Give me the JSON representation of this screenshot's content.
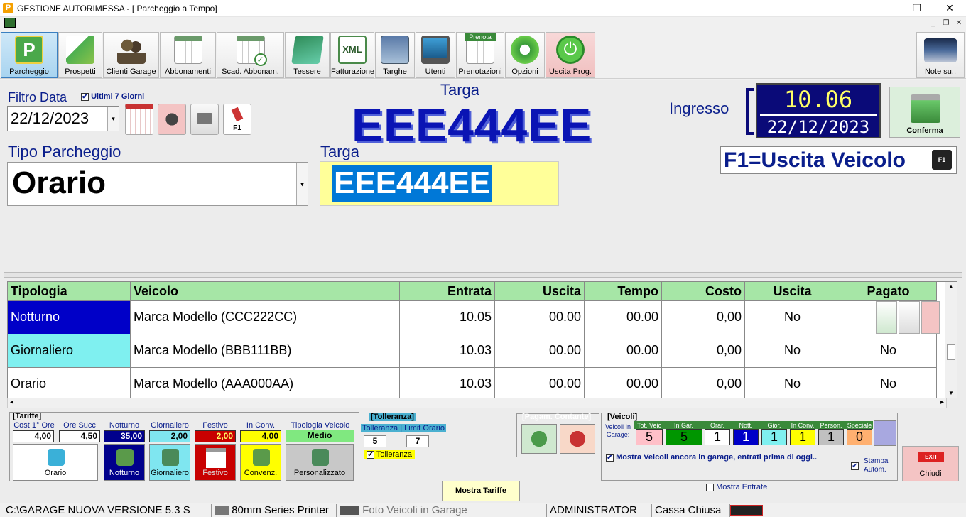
{
  "window": {
    "title": "GESTIONE AUTORIMESSA - [ Parcheggio a Tempo]",
    "app_icon": "P",
    "controls": [
      "–",
      "❐",
      "✕"
    ],
    "mdi_controls": [
      "_",
      "❐",
      "✕"
    ]
  },
  "toolbar": {
    "buttons": [
      {
        "label": "Parcheggio",
        "icon": "parking-icon"
      },
      {
        "label": "Prospetti",
        "icon": "chart-growth-icon"
      },
      {
        "label": "Clienti Garage",
        "icon": "users-icon"
      },
      {
        "label": "Abbonamenti",
        "icon": "calendar-icon"
      },
      {
        "label": "Scad. Abbonam.",
        "icon": "calendar-check-icon"
      },
      {
        "label": "Tessere",
        "icon": "card-icon"
      },
      {
        "label": "Fatturazione",
        "icon": "xml-icon"
      },
      {
        "label": "Targhe",
        "icon": "plates-icon"
      },
      {
        "label": "Utenti",
        "icon": "monitor-icon"
      },
      {
        "label": "Prenotazioni",
        "icon": "booking-icon",
        "badge": "Prenota"
      },
      {
        "label": "Opzioni",
        "icon": "gear-icon"
      },
      {
        "label": "Uscita Prog.",
        "icon": "power-icon"
      },
      {
        "label": "Note su..",
        "icon": "notes-icon"
      }
    ]
  },
  "filter": {
    "label": "Filtro Data",
    "checkbox_label": "Ultimi 7 Giorni",
    "checked": "✔",
    "date": "22/12/2023",
    "dropdown_arrow": "▾",
    "f1_label": "F1"
  },
  "plate_display": {
    "label": "Targa",
    "value": "EEE444EE"
  },
  "tipo": {
    "label": "Tipo Parcheggio",
    "value": "Orario",
    "dropdown_arrow": "▾"
  },
  "targa_input": {
    "label": "Targa",
    "value": "EEE444EE"
  },
  "ingresso": {
    "label": "Ingresso",
    "time": "10.06",
    "date": "22/12/2023"
  },
  "conferma": {
    "label": "Conferma"
  },
  "f1_hint": {
    "label": "F1=Uscita Veicolo",
    "key": "F1"
  },
  "grid": {
    "columns": [
      "Tipologia",
      "Veicolo",
      "Entrata",
      "Uscita",
      "Tempo",
      "Costo",
      "Uscita",
      "Pagato"
    ],
    "rows": [
      {
        "tipologia": "Notturno",
        "veicolo": "Marca Modello (CCC222CC)",
        "entrata": "10.05",
        "uscita": "00.00",
        "tempo": "00.00",
        "costo": "0,00",
        "uscita2": "No",
        "pagato": "",
        "color": "#0000c8",
        "textcolor": "#ffffff"
      },
      {
        "tipologia": "Giornaliero",
        "veicolo": "Marca Modello (BBB111BB)",
        "entrata": "10.03",
        "uscita": "00.00",
        "tempo": "00.00",
        "costo": "0,00",
        "uscita2": "No",
        "pagato": "No",
        "color": "#7ff0f0",
        "textcolor": "#000000"
      },
      {
        "tipologia": "Orario",
        "veicolo": "Marca Modello (AAA000AA)",
        "entrata": "10.03",
        "uscita": "00.00",
        "tempo": "00.00",
        "costo": "0,00",
        "uscita2": "No",
        "pagato": "No",
        "color": "#ffffff",
        "textcolor": "#000000"
      }
    ],
    "scroll_up": "▲",
    "scroll_down": "▼",
    "scroll_left": "◂",
    "scroll_right": "▸"
  },
  "tariffe": {
    "title": "[Tariffe]",
    "cost_first_label": "Cost 1° Ore",
    "cost_first": "4,00",
    "ore_succ_label": "Ore Succ",
    "ore_succ": "4,50",
    "items": [
      {
        "label": "Notturno",
        "value": "35,00",
        "btn": "Notturno",
        "bg": "#00008c",
        "fg": "#ffffff"
      },
      {
        "label": "Giornaliero",
        "value": "2,00",
        "btn": "Giornaliero",
        "bg": "#7fe6f0",
        "fg": "#000000"
      },
      {
        "label": "Festivo",
        "value": "2,00",
        "btn": "Festivo",
        "bg": "#c80000",
        "fg": "#ffff66"
      },
      {
        "label": "In Conv.",
        "value": "4,00",
        "btn": "Convenz.",
        "bg": "#ffff00",
        "fg": "#000000"
      }
    ],
    "tipologia_label": "Tipologia Veicolo",
    "tipologia_value": "Medio",
    "personalizzato": "Personalizzato",
    "orario_btn": "Orario"
  },
  "tolleranza": {
    "title": "[Tolleranza]",
    "sub_label": "Tolleranza | Limit Orario",
    "tol": "5",
    "limit": "7",
    "checkbox": "Tolleranza"
  },
  "pagamenti": {
    "title": "[Pagam. Contante]"
  },
  "veicoli": {
    "title": "[Veicoli]",
    "side_label": "Veicoli In Garage:",
    "heads": [
      "Tot. Veic",
      "In Gar.",
      "Orar.",
      "Nott.",
      "Gior.",
      "In Conv.",
      "Person.",
      "Speciale"
    ],
    "values": [
      "5",
      "5",
      "1",
      "1",
      "1",
      "1",
      "1",
      "0"
    ],
    "colors": [
      "#ffc0c8",
      "#009600",
      "#ffffff",
      "#0000c8",
      "#7ff0f0",
      "#ffff00",
      "#c0c0c0",
      "#ffb070"
    ],
    "mostra_label": "Mostra Veicoli ancora in garage, entrati prima di oggi..",
    "stampa_label": "Stampa Autom.",
    "mostra_entrate": "Mostra Entrate"
  },
  "chiudi": {
    "label": "Chiudi",
    "badge": "EXIT"
  },
  "mostra_tariffe": {
    "label": "Mostra Tariffe"
  },
  "statusbar": {
    "path": "C:\\GARAGE NUOVA VERSIONE 5.3 S",
    "printer": "80mm Series Printer",
    "photos": "Foto Veicoli in Garage",
    "user": "ADMINISTRATOR",
    "cassa": "Cassa Chiusa"
  }
}
